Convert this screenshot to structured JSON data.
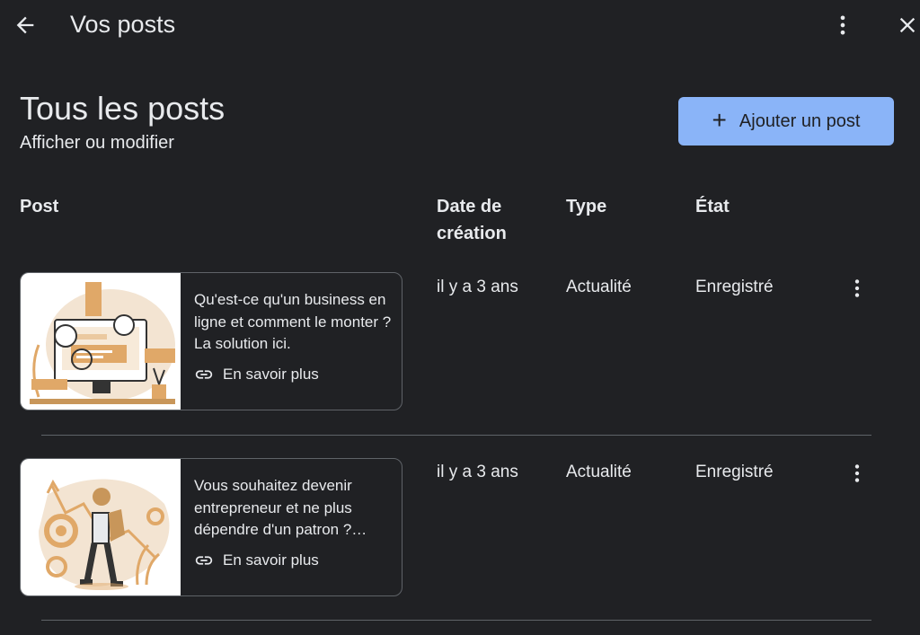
{
  "topbar": {
    "title": "Vos posts",
    "back_icon": "arrow-left-icon",
    "more_icon": "more-vert-icon",
    "close_icon": "close-icon"
  },
  "header": {
    "title": "Tous les posts",
    "subtitle": "Afficher ou modifier",
    "add_button_label": "Ajouter un post"
  },
  "table": {
    "columns": [
      "Post",
      "Date de création",
      "Type",
      "État"
    ],
    "rows": [
      {
        "text": "Qu'est-ce qu'un business en ligne et comment le monter ? La solution ici.",
        "link_label": "En savoir plus",
        "date": "il y a 3 ans",
        "type": "Actualité",
        "state": "Enregistré"
      },
      {
        "text": "Vous souhaitez devenir entrepreneur et ne plus dépendre d'un patron ?…",
        "link_label": "En savoir plus",
        "date": "il y a 3 ans",
        "type": "Actualité",
        "state": "Enregistré"
      }
    ]
  },
  "colors": {
    "background": "#202124",
    "accent": "#8ab4f8",
    "text": "#e8eaed",
    "border": "#5f6368",
    "illustration": "#e0a868"
  }
}
